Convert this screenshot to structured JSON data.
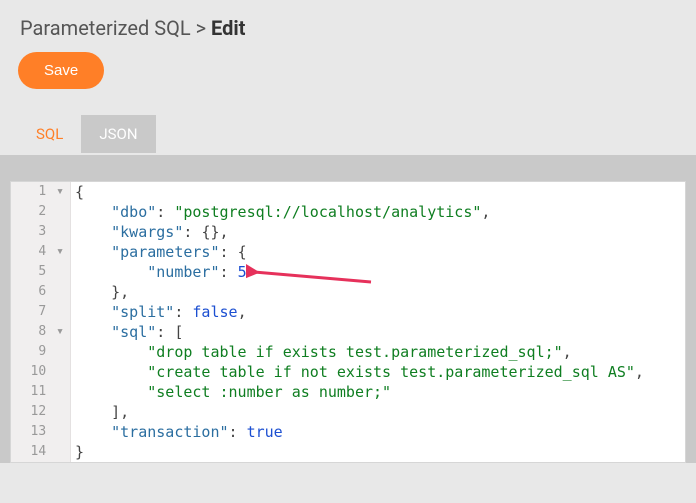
{
  "breadcrumb": {
    "parent": "Parameterized SQL",
    "sep": ">",
    "current": "Edit"
  },
  "buttons": {
    "save": "Save"
  },
  "tabs": {
    "sql": "SQL",
    "json": "JSON"
  },
  "editor": {
    "lines": [
      {
        "n": "1",
        "fold": true,
        "segs": [
          {
            "t": "{",
            "c": "punc"
          }
        ]
      },
      {
        "n": "2",
        "fold": false,
        "segs": [
          {
            "t": "    ",
            "c": ""
          },
          {
            "t": "\"dbo\"",
            "c": "key"
          },
          {
            "t": ": ",
            "c": "punc"
          },
          {
            "t": "\"postgresql://localhost/analytics\"",
            "c": "str"
          },
          {
            "t": ",",
            "c": "punc"
          }
        ]
      },
      {
        "n": "3",
        "fold": false,
        "segs": [
          {
            "t": "    ",
            "c": ""
          },
          {
            "t": "\"kwargs\"",
            "c": "key"
          },
          {
            "t": ": ",
            "c": "punc"
          },
          {
            "t": "{}",
            "c": "punc"
          },
          {
            "t": ",",
            "c": "punc"
          }
        ]
      },
      {
        "n": "4",
        "fold": true,
        "segs": [
          {
            "t": "    ",
            "c": ""
          },
          {
            "t": "\"parameters\"",
            "c": "key"
          },
          {
            "t": ": ",
            "c": "punc"
          },
          {
            "t": "{",
            "c": "punc"
          }
        ]
      },
      {
        "n": "5",
        "fold": false,
        "segs": [
          {
            "t": "        ",
            "c": ""
          },
          {
            "t": "\"number\"",
            "c": "key"
          },
          {
            "t": ": ",
            "c": "punc"
          },
          {
            "t": "5",
            "c": "num"
          }
        ]
      },
      {
        "n": "6",
        "fold": false,
        "segs": [
          {
            "t": "    ",
            "c": ""
          },
          {
            "t": "}",
            "c": "punc"
          },
          {
            "t": ",",
            "c": "punc"
          }
        ]
      },
      {
        "n": "7",
        "fold": false,
        "segs": [
          {
            "t": "    ",
            "c": ""
          },
          {
            "t": "\"split\"",
            "c": "key"
          },
          {
            "t": ": ",
            "c": "punc"
          },
          {
            "t": "false",
            "c": "bool"
          },
          {
            "t": ",",
            "c": "punc"
          }
        ]
      },
      {
        "n": "8",
        "fold": true,
        "segs": [
          {
            "t": "    ",
            "c": ""
          },
          {
            "t": "\"sql\"",
            "c": "key"
          },
          {
            "t": ": ",
            "c": "punc"
          },
          {
            "t": "[",
            "c": "punc"
          }
        ]
      },
      {
        "n": "9",
        "fold": false,
        "segs": [
          {
            "t": "        ",
            "c": ""
          },
          {
            "t": "\"drop table if exists test.parameterized_sql;\"",
            "c": "str"
          },
          {
            "t": ",",
            "c": "punc"
          }
        ]
      },
      {
        "n": "10",
        "fold": false,
        "segs": [
          {
            "t": "        ",
            "c": ""
          },
          {
            "t": "\"create table if not exists test.parameterized_sql AS\"",
            "c": "str"
          },
          {
            "t": ",",
            "c": "punc"
          }
        ]
      },
      {
        "n": "11",
        "fold": false,
        "segs": [
          {
            "t": "        ",
            "c": ""
          },
          {
            "t": "\"select :number as number;\"",
            "c": "str"
          }
        ]
      },
      {
        "n": "12",
        "fold": false,
        "segs": [
          {
            "t": "    ",
            "c": ""
          },
          {
            "t": "]",
            "c": "punc"
          },
          {
            "t": ",",
            "c": "punc"
          }
        ]
      },
      {
        "n": "13",
        "fold": false,
        "segs": [
          {
            "t": "    ",
            "c": ""
          },
          {
            "t": "\"transaction\"",
            "c": "key"
          },
          {
            "t": ": ",
            "c": "punc"
          },
          {
            "t": "true",
            "c": "bool"
          }
        ]
      },
      {
        "n": "14",
        "fold": false,
        "segs": [
          {
            "t": "}",
            "c": "punc"
          }
        ]
      }
    ]
  },
  "annotation": {
    "arrow_color": "#e6315b"
  }
}
